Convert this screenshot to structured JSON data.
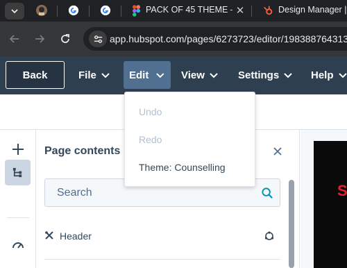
{
  "browser": {
    "tabs": [
      {
        "icon": "google-icon",
        "title": ""
      },
      {
        "icon": "google-icon",
        "title": ""
      },
      {
        "icon": "figma-icon",
        "title": "PACK OF 45 THEME – F"
      },
      {
        "icon": "hubspot-icon",
        "title": "Design Manager | "
      }
    ],
    "url": "app.hubspot.com/pages/6273723/editor/198388764313"
  },
  "header": {
    "back_label": "Back",
    "menu": [
      "File",
      "Edit",
      "View",
      "Settings",
      "Help"
    ],
    "active_menu": "Edit"
  },
  "edit_menu": {
    "items": [
      {
        "label": "Undo",
        "enabled": false
      },
      {
        "label": "Redo",
        "enabled": false
      },
      {
        "label": "Theme: Counselling",
        "enabled": true
      }
    ]
  },
  "panel": {
    "title": "Page contents",
    "search_placeholder": "Search",
    "rows": [
      {
        "label": "Header"
      }
    ]
  },
  "preview": {
    "visible_text": "S"
  },
  "colors": {
    "header_bg": "#2e3f50",
    "active_menu_bg": "#516f90",
    "accent": "#0091ae",
    "preview_text": "#e8202a"
  }
}
